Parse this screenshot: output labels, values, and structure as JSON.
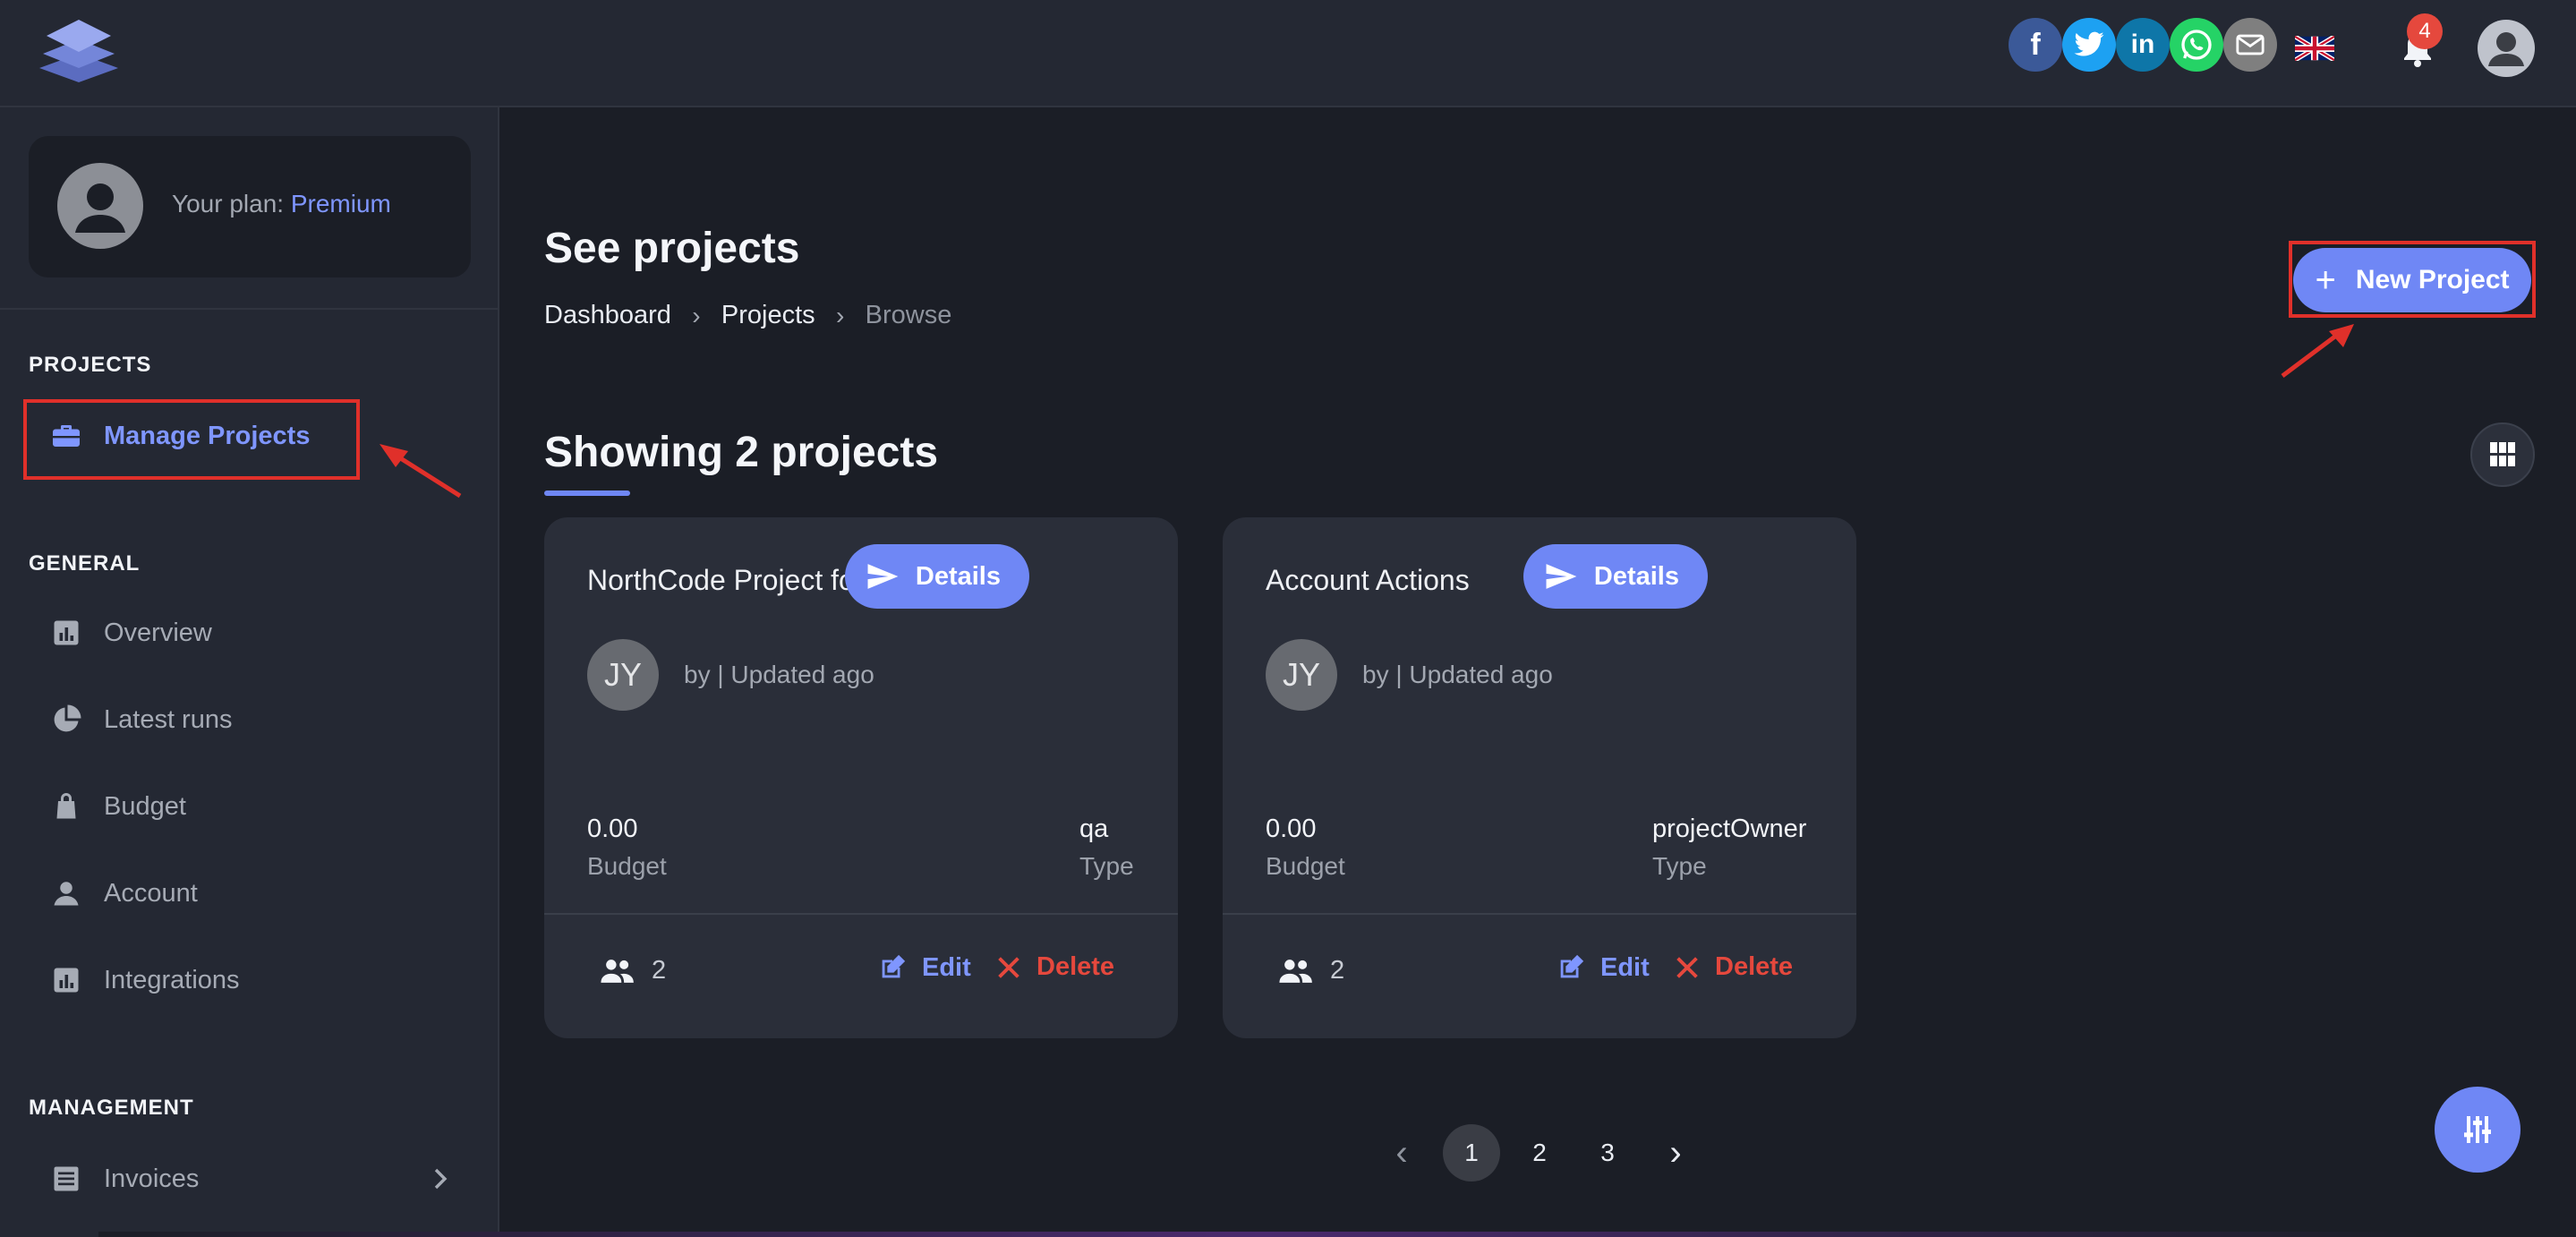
{
  "header": {
    "social": [
      {
        "name": "facebook-icon",
        "glyph": "f",
        "color": "#3b5998"
      },
      {
        "name": "twitter-icon",
        "glyph": "",
        "color": "#1da1f2"
      },
      {
        "name": "linkedin-icon",
        "glyph": "in",
        "color": "#0e76a8"
      },
      {
        "name": "whatsapp-icon",
        "glyph": "",
        "color": "#25d366"
      },
      {
        "name": "email-icon",
        "glyph": "",
        "color": "#7f7f7f"
      }
    ],
    "notification_count": "4"
  },
  "sidebar": {
    "plan_label": "Your plan:",
    "plan_value": "Premium",
    "sections": {
      "projects": "PROJECTS",
      "general": "GENERAL",
      "management": "MANAGEMENT"
    },
    "items": {
      "manage_projects": "Manage Projects",
      "overview": "Overview",
      "latest_runs": "Latest runs",
      "budget": "Budget",
      "account": "Account",
      "integrations": "Integrations",
      "invoices": "Invoices"
    }
  },
  "main": {
    "title": "See projects",
    "breadcrumb": [
      "Dashboard",
      "Projects",
      "Browse"
    ],
    "new_project_label": "New Project",
    "showing": "Showing 2 projects",
    "cards": [
      {
        "name": "NorthCode Project for Test Cases",
        "details_label": "Details",
        "avatar_initials": "JY",
        "meta": "by | Updated ago",
        "budget_value": "0.00",
        "budget_label": "Budget",
        "type_value": "qa",
        "type_label": "Type",
        "members": "2",
        "edit_label": "Edit",
        "delete_label": "Delete"
      },
      {
        "name": "Account Actions",
        "details_label": "Details",
        "avatar_initials": "JY",
        "meta": "by | Updated ago",
        "budget_value": "0.00",
        "budget_label": "Budget",
        "type_value": "projectOwner",
        "type_label": "Type",
        "members": "2",
        "edit_label": "Edit",
        "delete_label": "Delete"
      }
    ],
    "pagination": [
      "1",
      "2",
      "3"
    ],
    "current_page": "1"
  },
  "colors": {
    "accent": "#6f87f5",
    "danger": "#e5483d",
    "annotation": "#e0302a",
    "background": "#1b1e26",
    "surface": "#242833"
  }
}
